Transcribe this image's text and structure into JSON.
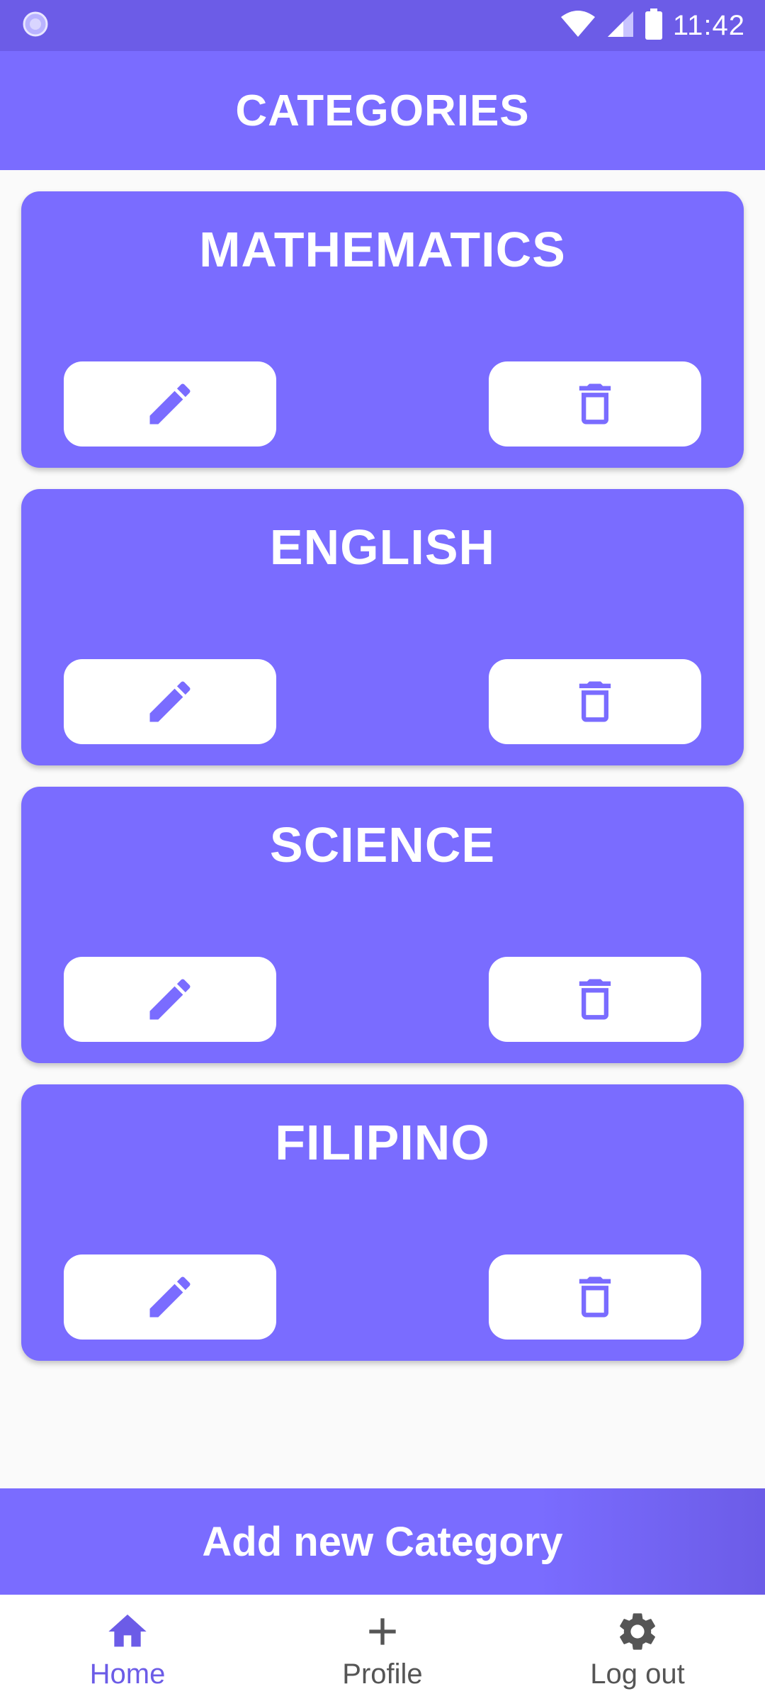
{
  "status_bar": {
    "time": "11:42"
  },
  "header": {
    "title": "CATEGORIES"
  },
  "categories": [
    {
      "name": "MATHEMATICS",
      "edit_icon": "pencil-icon",
      "delete_icon": "trash-icon"
    },
    {
      "name": "ENGLISH",
      "edit_icon": "pencil-icon",
      "delete_icon": "trash-icon"
    },
    {
      "name": "SCIENCE",
      "edit_icon": "pencil-icon",
      "delete_icon": "trash-icon"
    },
    {
      "name": "FILIPINO",
      "edit_icon": "pencil-icon",
      "delete_icon": "trash-icon"
    }
  ],
  "actions": {
    "add_label": "Add new Category"
  },
  "bottom_nav": {
    "items": [
      {
        "label": "Home",
        "icon": "home-icon",
        "active": true
      },
      {
        "label": "Profile",
        "icon": "plus-icon",
        "active": false
      },
      {
        "label": "Log out",
        "icon": "gear-icon",
        "active": false
      }
    ]
  },
  "colors": {
    "primary": "#7a6cff",
    "primary_dark": "#6c5ce7",
    "background": "#fafafa",
    "card_button": "#ffffff"
  }
}
